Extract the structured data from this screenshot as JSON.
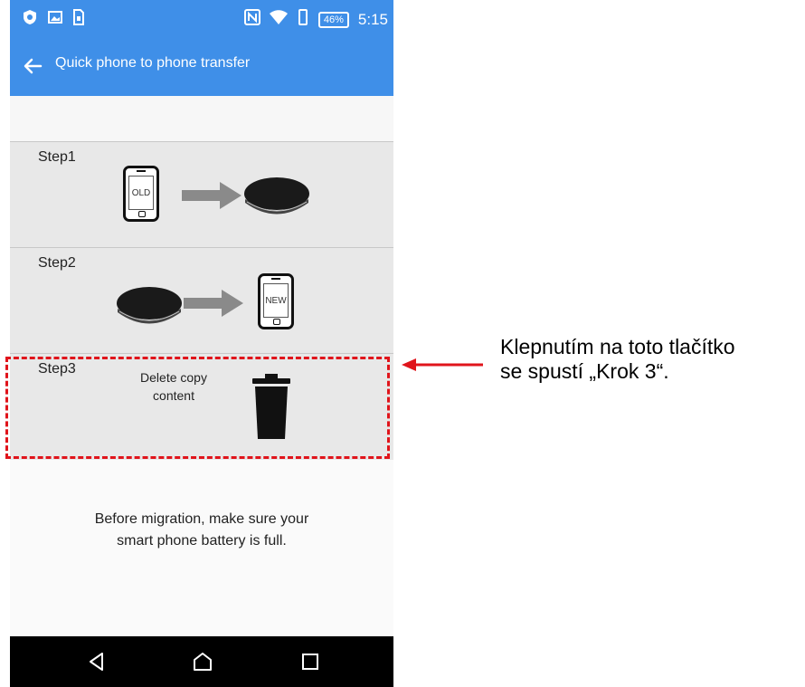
{
  "status_bar": {
    "battery": "46%",
    "time": "5:15",
    "icons": [
      "shield-icon",
      "image-icon",
      "sim-icon",
      "nfc-icon",
      "wifi-icon",
      "vibrate-icon",
      "battery-icon"
    ]
  },
  "app_bar": {
    "title": "Quick phone to phone transfer",
    "back_icon": "arrow-left-icon"
  },
  "steps": [
    {
      "label": "Step1",
      "phone_label": "OLD"
    },
    {
      "label": "Step2",
      "phone_label": "NEW"
    },
    {
      "label": "Step3",
      "action_line1": "Delete copy",
      "action_line2": "content",
      "icon": "trash-icon"
    }
  ],
  "info": {
    "line1": "Before migration, make sure your",
    "line2": "smart phone battery is full."
  },
  "nav": [
    "back-icon",
    "home-icon",
    "recents-icon"
  ],
  "annotation": {
    "line1": "Klepnutím na toto tlačítko",
    "line2": "se spustí „Krok 3“."
  },
  "colors": {
    "app_bar": "#3f8fe8",
    "highlight": "#e0141b",
    "step_background": "#e8e8e8"
  }
}
